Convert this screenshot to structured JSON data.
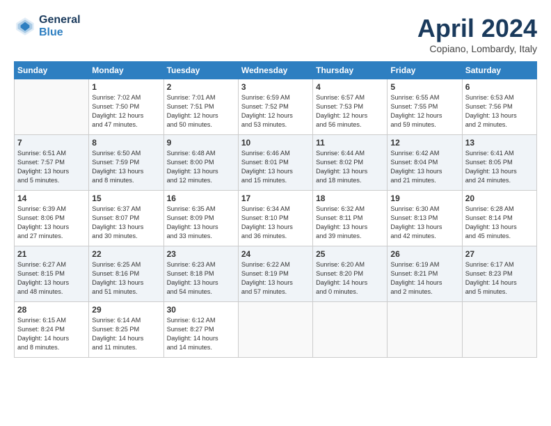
{
  "header": {
    "logo_line1": "General",
    "logo_line2": "Blue",
    "month": "April 2024",
    "location": "Copiano, Lombardy, Italy"
  },
  "columns": [
    "Sunday",
    "Monday",
    "Tuesday",
    "Wednesday",
    "Thursday",
    "Friday",
    "Saturday"
  ],
  "weeks": [
    [
      {
        "day": "",
        "info": ""
      },
      {
        "day": "1",
        "info": "Sunrise: 7:02 AM\nSunset: 7:50 PM\nDaylight: 12 hours\nand 47 minutes."
      },
      {
        "day": "2",
        "info": "Sunrise: 7:01 AM\nSunset: 7:51 PM\nDaylight: 12 hours\nand 50 minutes."
      },
      {
        "day": "3",
        "info": "Sunrise: 6:59 AM\nSunset: 7:52 PM\nDaylight: 12 hours\nand 53 minutes."
      },
      {
        "day": "4",
        "info": "Sunrise: 6:57 AM\nSunset: 7:53 PM\nDaylight: 12 hours\nand 56 minutes."
      },
      {
        "day": "5",
        "info": "Sunrise: 6:55 AM\nSunset: 7:55 PM\nDaylight: 12 hours\nand 59 minutes."
      },
      {
        "day": "6",
        "info": "Sunrise: 6:53 AM\nSunset: 7:56 PM\nDaylight: 13 hours\nand 2 minutes."
      }
    ],
    [
      {
        "day": "7",
        "info": "Sunrise: 6:51 AM\nSunset: 7:57 PM\nDaylight: 13 hours\nand 5 minutes."
      },
      {
        "day": "8",
        "info": "Sunrise: 6:50 AM\nSunset: 7:59 PM\nDaylight: 13 hours\nand 8 minutes."
      },
      {
        "day": "9",
        "info": "Sunrise: 6:48 AM\nSunset: 8:00 PM\nDaylight: 13 hours\nand 12 minutes."
      },
      {
        "day": "10",
        "info": "Sunrise: 6:46 AM\nSunset: 8:01 PM\nDaylight: 13 hours\nand 15 minutes."
      },
      {
        "day": "11",
        "info": "Sunrise: 6:44 AM\nSunset: 8:02 PM\nDaylight: 13 hours\nand 18 minutes."
      },
      {
        "day": "12",
        "info": "Sunrise: 6:42 AM\nSunset: 8:04 PM\nDaylight: 13 hours\nand 21 minutes."
      },
      {
        "day": "13",
        "info": "Sunrise: 6:41 AM\nSunset: 8:05 PM\nDaylight: 13 hours\nand 24 minutes."
      }
    ],
    [
      {
        "day": "14",
        "info": "Sunrise: 6:39 AM\nSunset: 8:06 PM\nDaylight: 13 hours\nand 27 minutes."
      },
      {
        "day": "15",
        "info": "Sunrise: 6:37 AM\nSunset: 8:07 PM\nDaylight: 13 hours\nand 30 minutes."
      },
      {
        "day": "16",
        "info": "Sunrise: 6:35 AM\nSunset: 8:09 PM\nDaylight: 13 hours\nand 33 minutes."
      },
      {
        "day": "17",
        "info": "Sunrise: 6:34 AM\nSunset: 8:10 PM\nDaylight: 13 hours\nand 36 minutes."
      },
      {
        "day": "18",
        "info": "Sunrise: 6:32 AM\nSunset: 8:11 PM\nDaylight: 13 hours\nand 39 minutes."
      },
      {
        "day": "19",
        "info": "Sunrise: 6:30 AM\nSunset: 8:13 PM\nDaylight: 13 hours\nand 42 minutes."
      },
      {
        "day": "20",
        "info": "Sunrise: 6:28 AM\nSunset: 8:14 PM\nDaylight: 13 hours\nand 45 minutes."
      }
    ],
    [
      {
        "day": "21",
        "info": "Sunrise: 6:27 AM\nSunset: 8:15 PM\nDaylight: 13 hours\nand 48 minutes."
      },
      {
        "day": "22",
        "info": "Sunrise: 6:25 AM\nSunset: 8:16 PM\nDaylight: 13 hours\nand 51 minutes."
      },
      {
        "day": "23",
        "info": "Sunrise: 6:23 AM\nSunset: 8:18 PM\nDaylight: 13 hours\nand 54 minutes."
      },
      {
        "day": "24",
        "info": "Sunrise: 6:22 AM\nSunset: 8:19 PM\nDaylight: 13 hours\nand 57 minutes."
      },
      {
        "day": "25",
        "info": "Sunrise: 6:20 AM\nSunset: 8:20 PM\nDaylight: 14 hours\nand 0 minutes."
      },
      {
        "day": "26",
        "info": "Sunrise: 6:19 AM\nSunset: 8:21 PM\nDaylight: 14 hours\nand 2 minutes."
      },
      {
        "day": "27",
        "info": "Sunrise: 6:17 AM\nSunset: 8:23 PM\nDaylight: 14 hours\nand 5 minutes."
      }
    ],
    [
      {
        "day": "28",
        "info": "Sunrise: 6:15 AM\nSunset: 8:24 PM\nDaylight: 14 hours\nand 8 minutes."
      },
      {
        "day": "29",
        "info": "Sunrise: 6:14 AM\nSunset: 8:25 PM\nDaylight: 14 hours\nand 11 minutes."
      },
      {
        "day": "30",
        "info": "Sunrise: 6:12 AM\nSunset: 8:27 PM\nDaylight: 14 hours\nand 14 minutes."
      },
      {
        "day": "",
        "info": ""
      },
      {
        "day": "",
        "info": ""
      },
      {
        "day": "",
        "info": ""
      },
      {
        "day": "",
        "info": ""
      }
    ]
  ]
}
